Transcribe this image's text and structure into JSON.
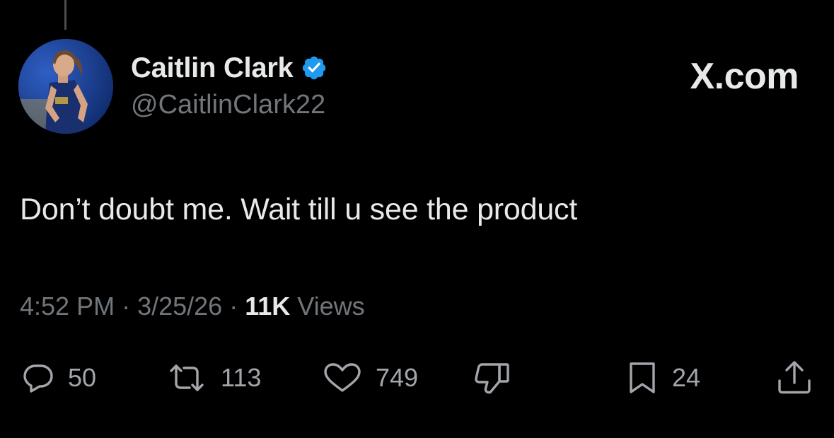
{
  "tweet": {
    "author": {
      "display_name": "Caitlin Clark",
      "handle": "@CaitlinClark22",
      "verified": true
    },
    "site_mark": "X.com",
    "text": "Don’t doubt me. Wait till u see the product",
    "time": "4:52 PM",
    "date": "3/25/26",
    "views_count": "11K",
    "views_label": "Views",
    "separator": "·"
  },
  "actions": {
    "reply_count": "50",
    "repost_count": "113",
    "like_count": "749",
    "bookmark_count": "24"
  },
  "colors": {
    "background": "#000000",
    "primary_text": "#e7e9ea",
    "secondary_text": "#71767b",
    "verified_blue": "#1d9bf0"
  },
  "icons": [
    "reply-icon",
    "repost-icon",
    "like-icon",
    "dislike-icon",
    "bookmark-icon",
    "share-icon",
    "verified-badge-icon"
  ]
}
